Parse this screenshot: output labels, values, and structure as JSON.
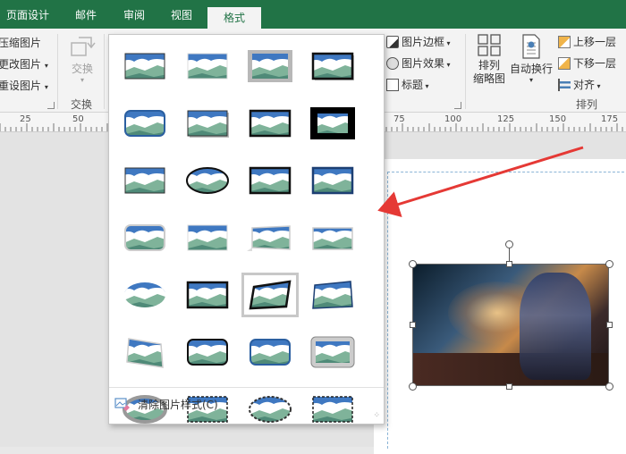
{
  "tabs": [
    {
      "label": "页面设计"
    },
    {
      "label": "邮件"
    },
    {
      "label": "审阅"
    },
    {
      "label": "视图"
    },
    {
      "label": "格式",
      "active": true
    }
  ],
  "ribbon": {
    "adjust": {
      "compress": "压缩图片",
      "change": "更改图片",
      "reset": "重设图片"
    },
    "swap": {
      "button": "交换",
      "group_label": "交换"
    },
    "picture_styles": {
      "border": "图片边框",
      "effects": "图片效果",
      "caption": "标题"
    },
    "arrange": {
      "arrange_thumbnails": "排列\n缩略图",
      "wrap": "自动换行",
      "bring_forward": "上移一层",
      "send_backward": "下移一层",
      "align": "对齐",
      "group_label": "排列"
    }
  },
  "ruler": {
    "labels": [
      "25",
      "50",
      "75",
      "100",
      "125",
      "150",
      "175"
    ]
  },
  "gallery": {
    "clear_label": "清除图片样式(C)",
    "rows": 7,
    "cols": 4,
    "hover_index": 18
  },
  "colors": {
    "accent": "#217346",
    "arrow": "#e53935"
  }
}
